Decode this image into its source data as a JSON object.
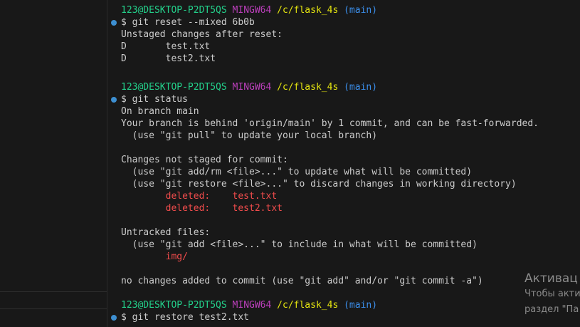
{
  "prompt": {
    "user": "123@DESKTOP-P2DT5QS",
    "system": "MINGW64",
    "path": "/c/flask_4s",
    "branch": "(main)"
  },
  "output": {
    "cmd_reset": "$ git reset --mixed 6b0b",
    "unstaged_header": "Unstaged changes after reset:",
    "reset_file_1": "D       test.txt",
    "reset_file_2": "D       test2.txt",
    "cmd_status": "$ git status",
    "on_branch": "On branch main",
    "behind": "Your branch is behind 'origin/main' by 1 commit, and can be fast-forwarded.",
    "hint_pull": "  (use \"git pull\" to update your local branch)",
    "not_staged": "Changes not staged for commit:",
    "hint_add_rm": "  (use \"git add/rm <file>...\" to update what will be committed)",
    "hint_restore": "  (use \"git restore <file>...\" to discard changes in working directory)",
    "deleted_1": "        deleted:    test.txt",
    "deleted_2": "        deleted:    test2.txt",
    "untracked": "Untracked files:",
    "hint_add": "  (use \"git add <file>...\" to include in what will be committed)",
    "untracked_1": "        img/",
    "no_changes": "no changes added to commit (use \"git add\" and/or \"git commit -a\")",
    "cmd_restore": "$ git restore test2.txt"
  },
  "watermark": {
    "title": "Активац",
    "line1": "Чтобы акти",
    "line2": "раздел \"Па"
  },
  "colors": {
    "background": "#181818",
    "user": "#23d18b",
    "mingw": "#bc3fbc",
    "path": "#e5e510",
    "branch": "#3b8eea",
    "deleted": "#f14c4c",
    "gutter_dot": "#3d8fd1"
  }
}
